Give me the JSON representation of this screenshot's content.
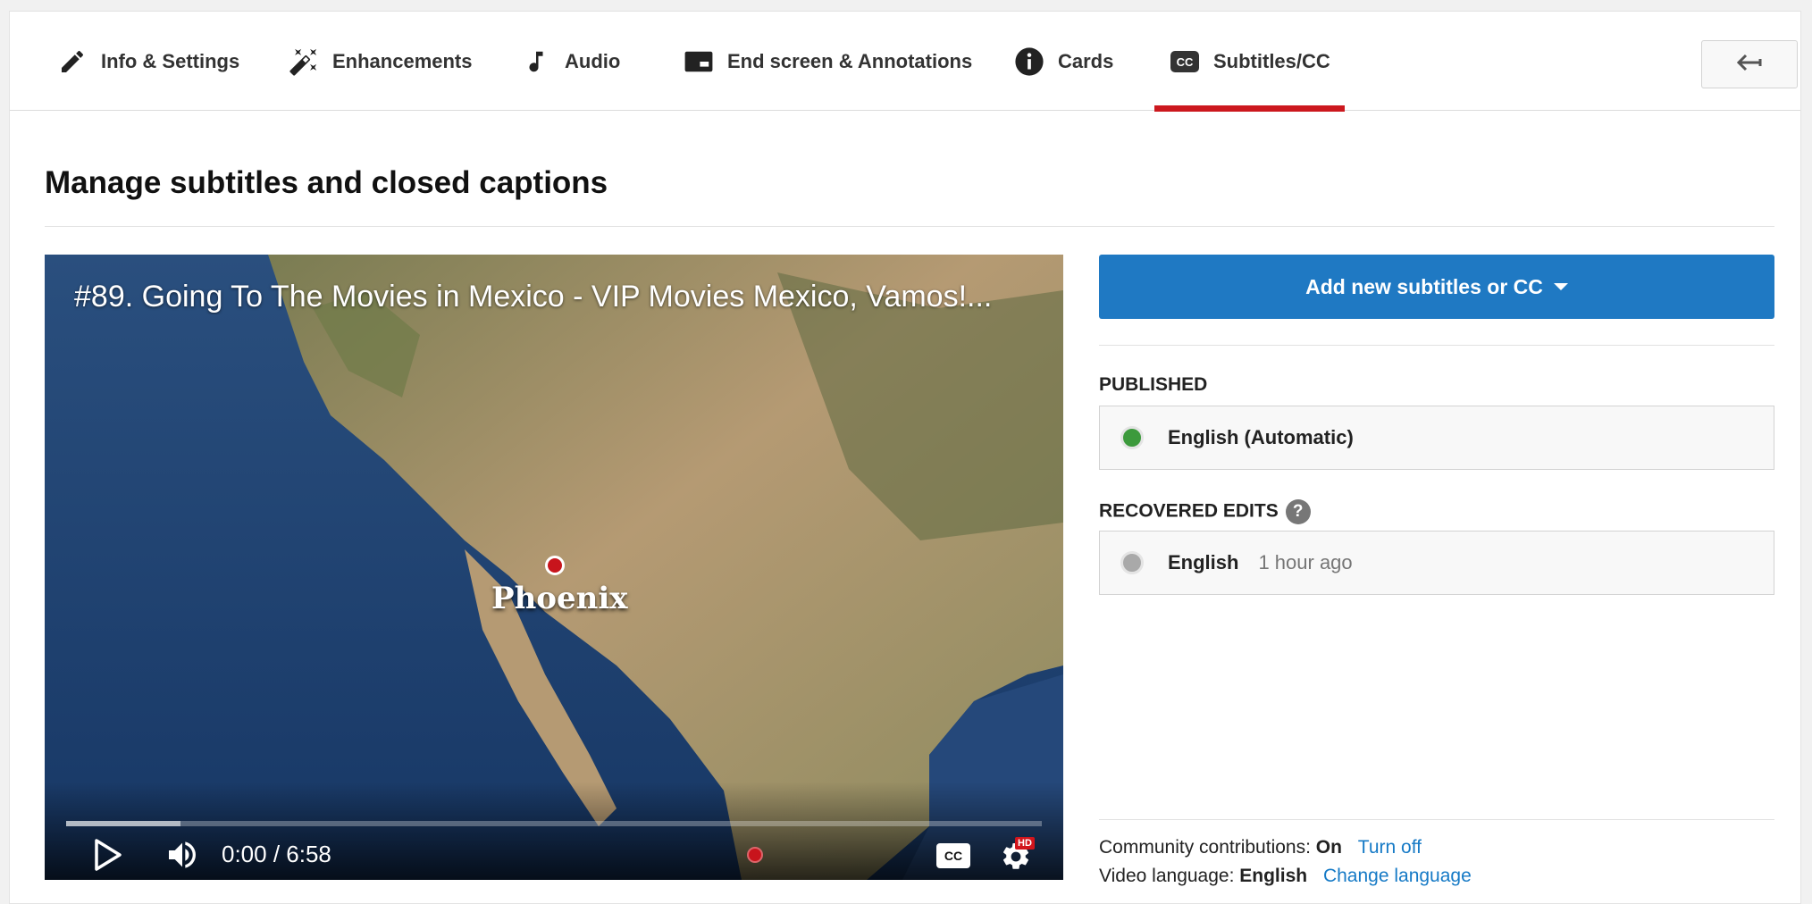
{
  "tabs": [
    {
      "label": "Info & Settings",
      "icon": "pencil-icon"
    },
    {
      "label": "Enhancements",
      "icon": "magic-wand-icon"
    },
    {
      "label": "Audio",
      "icon": "music-note-icon"
    },
    {
      "label": "End screen & Annotations",
      "icon": "end-screen-icon"
    },
    {
      "label": "Cards",
      "icon": "info-icon"
    },
    {
      "label": "Subtitles/CC",
      "icon": "cc-icon",
      "active": true
    }
  ],
  "page": {
    "title": "Manage subtitles and closed captions"
  },
  "player": {
    "title": "#89. Going To The Movies in Mexico - VIP Movies Mexico, Vamos!...",
    "map_label": "Phoenix",
    "time": "0:00 / 6:58",
    "cc": "CC",
    "hd": "HD",
    "buffered_fraction": 0.117
  },
  "add_button": {
    "label": "Add new subtitles or CC"
  },
  "published": {
    "label": "PUBLISHED",
    "items": [
      {
        "name": "English (Automatic)",
        "status_color": "#3c9a3c"
      }
    ]
  },
  "recovered": {
    "label": "RECOVERED EDITS",
    "help": "?",
    "items": [
      {
        "name": "English",
        "time": "1 hour ago",
        "status_color": "#a9a9a9"
      }
    ]
  },
  "footer": {
    "community_label": "Community contributions:",
    "community_value": "On",
    "community_link": "Turn off",
    "language_label": "Video language:",
    "language_value": "English",
    "language_link": "Change language"
  },
  "colors": {
    "accent": "#1f79c3",
    "active_tab": "#cc181e",
    "link": "#167ac6"
  }
}
